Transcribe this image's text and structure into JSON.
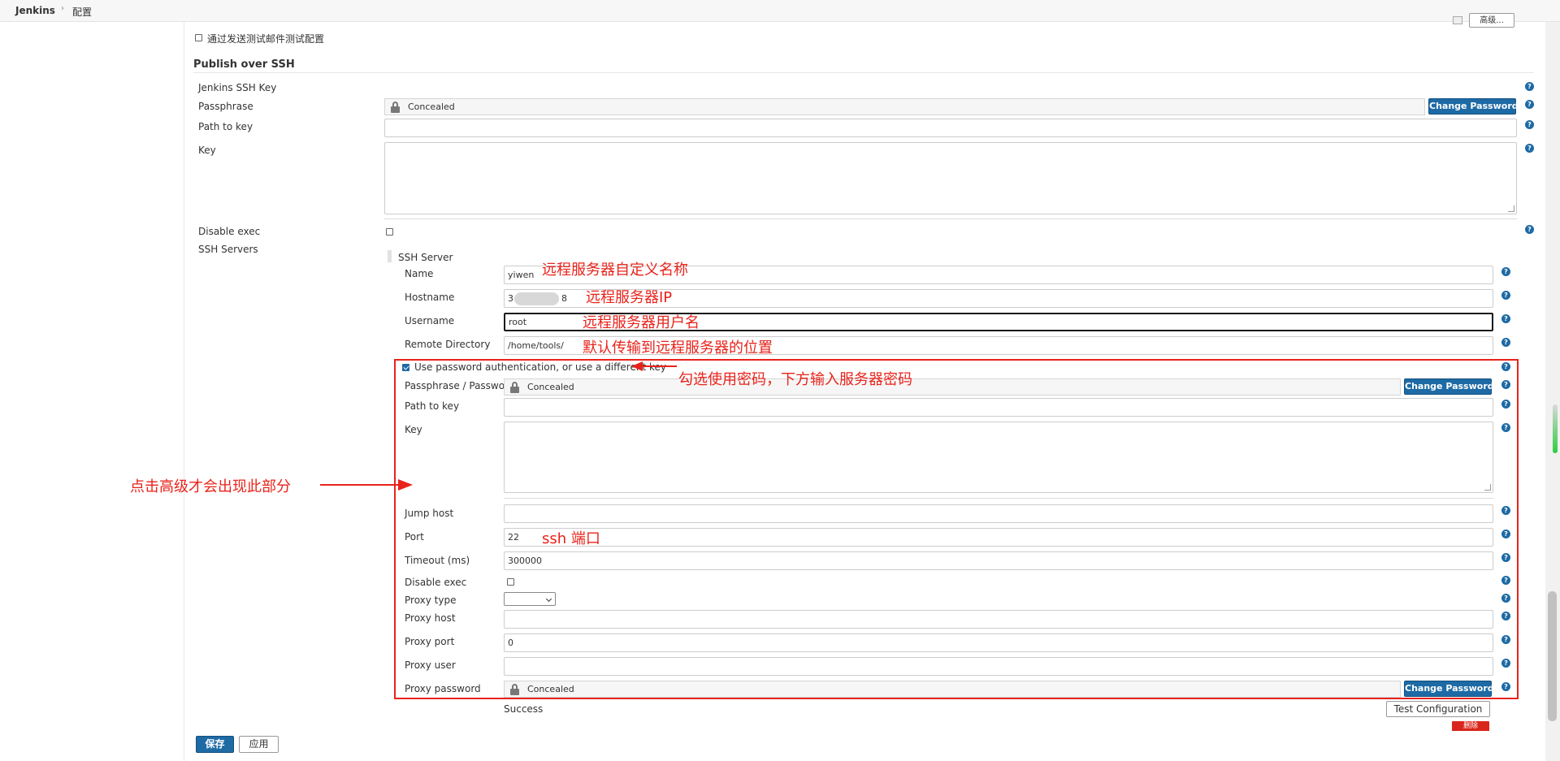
{
  "breadcrumb": {
    "root": "Jenkins",
    "separator": "›",
    "current": "配置"
  },
  "top_section": {
    "test_email_checkbox_label": "通过发送测试邮件测试配置",
    "advanced_button": "高级..."
  },
  "publish_ssh": {
    "title": "Publish over SSH",
    "jenkins_ssh_key_label": "Jenkins SSH Key",
    "passphrase_label": "Passphrase",
    "passphrase_value": "Concealed",
    "change_password": "Change Password",
    "path_to_key_label": "Path to key",
    "key_label": "Key",
    "disable_exec_label": "Disable exec",
    "ssh_servers_label": "SSH Servers"
  },
  "ssh_server": {
    "header": "SSH Server",
    "name_label": "Name",
    "name_value": "yiwen",
    "hostname_label": "Hostname",
    "hostname_prefix": "3",
    "hostname_suffix": "8",
    "username_label": "Username",
    "username_value": "root",
    "remote_dir_label": "Remote Directory",
    "remote_dir_value": "/home/tools/",
    "use_password_label": "Use password authentication, or use a different key",
    "passphrase_password_label": "Passphrase / Password",
    "passphrase_password_value": "Concealed",
    "path_to_key_label": "Path to key",
    "key_label": "Key",
    "jump_host_label": "Jump host",
    "port_label": "Port",
    "port_value": "22",
    "timeout_label": "Timeout (ms)",
    "timeout_value": "300000",
    "disable_exec_label": "Disable exec",
    "proxy_type_label": "Proxy type",
    "proxy_host_label": "Proxy host",
    "proxy_port_label": "Proxy port",
    "proxy_port_value": "0",
    "proxy_user_label": "Proxy user",
    "proxy_password_label": "Proxy password",
    "proxy_password_value": "Concealed",
    "status_text": "Success",
    "test_config_button": "Test Configuration",
    "delete_button": "删除"
  },
  "footer": {
    "save_button": "保存",
    "apply_button": "应用"
  },
  "help_glyph": "?",
  "annotations": {
    "name": "远程服务器自定义名称",
    "ip": "远程服务器IP",
    "user": "远程服务器用户名",
    "location": "默认传输到远程服务器的位置",
    "password": "勾选使用密码，下方输入服务器密码",
    "advanced": "点击高级才会出现此部分",
    "port": "ssh 端口"
  },
  "colors": {
    "accent": "#1d6aa5",
    "annotation": "#e8231b"
  },
  "icons": [
    "lock-icon",
    "help-icon",
    "checkbox-icon",
    "arrow-icon"
  ]
}
